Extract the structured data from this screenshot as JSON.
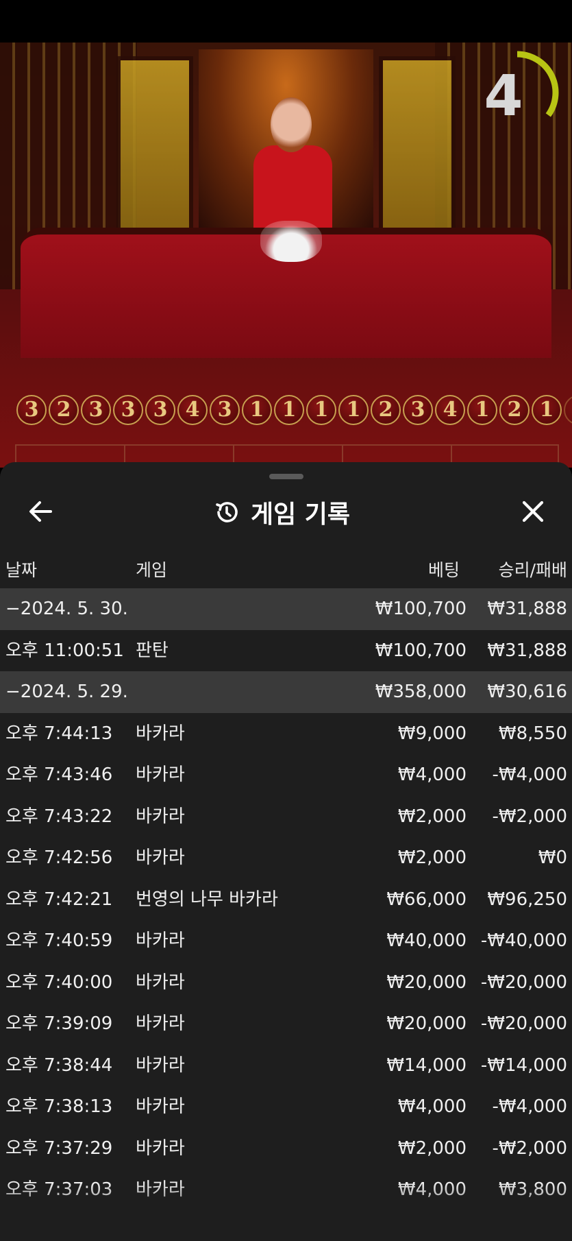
{
  "timer": {
    "value": "4",
    "progress": 0.35
  },
  "beads": [
    "3",
    "2",
    "3",
    "3",
    "3",
    "4",
    "3",
    "1",
    "1",
    "1",
    "1",
    "2",
    "3",
    "4",
    "1",
    "2",
    "1",
    "1"
  ],
  "history": {
    "title": "게임 기록",
    "columns": {
      "date": "날짜",
      "game": "게임",
      "bet": "베팅",
      "win_loss": "승리/패배"
    },
    "rows": [
      {
        "date": "−2024. 5. 30.",
        "game": "",
        "bet": "₩100,700",
        "win_loss": "₩31,888",
        "group": true
      },
      {
        "date": "오후 11:00:51",
        "game": "판탄",
        "bet": "₩100,700",
        "win_loss": "₩31,888",
        "group": false
      },
      {
        "date": "−2024. 5. 29.",
        "game": "",
        "bet": "₩358,000",
        "win_loss": "₩30,616",
        "group": true
      },
      {
        "date": "오후 7:44:13",
        "game": "바카라",
        "bet": "₩9,000",
        "win_loss": "₩8,550",
        "group": false
      },
      {
        "date": "오후 7:43:46",
        "game": "바카라",
        "bet": "₩4,000",
        "win_loss": "-₩4,000",
        "group": false
      },
      {
        "date": "오후 7:43:22",
        "game": "바카라",
        "bet": "₩2,000",
        "win_loss": "-₩2,000",
        "group": false
      },
      {
        "date": "오후 7:42:56",
        "game": "바카라",
        "bet": "₩2,000",
        "win_loss": "₩0",
        "group": false
      },
      {
        "date": "오후 7:42:21",
        "game": "번영의 나무 바카라",
        "bet": "₩66,000",
        "win_loss": "₩96,250",
        "group": false
      },
      {
        "date": "오후 7:40:59",
        "game": "바카라",
        "bet": "₩40,000",
        "win_loss": "-₩40,000",
        "group": false
      },
      {
        "date": "오후 7:40:00",
        "game": "바카라",
        "bet": "₩20,000",
        "win_loss": "-₩20,000",
        "group": false
      },
      {
        "date": "오후 7:39:09",
        "game": "바카라",
        "bet": "₩20,000",
        "win_loss": "-₩20,000",
        "group": false
      },
      {
        "date": "오후 7:38:44",
        "game": "바카라",
        "bet": "₩14,000",
        "win_loss": "-₩14,000",
        "group": false
      },
      {
        "date": "오후 7:38:13",
        "game": "바카라",
        "bet": "₩4,000",
        "win_loss": "-₩4,000",
        "group": false
      },
      {
        "date": "오후 7:37:29",
        "game": "바카라",
        "bet": "₩2,000",
        "win_loss": "-₩2,000",
        "group": false
      },
      {
        "date": "오후 7:37:03",
        "game": "바카라",
        "bet": "₩4,000",
        "win_loss": "₩3,800",
        "group": false
      }
    ]
  },
  "colors": {
    "sheet_bg": "#1e1e1e",
    "group_row_bg": "#3a3a3a",
    "timer_arc": "#b8c414",
    "bead_border": "#c8a050"
  },
  "icons": {
    "back": "arrow-left-icon",
    "history": "history-icon",
    "close": "close-icon"
  }
}
